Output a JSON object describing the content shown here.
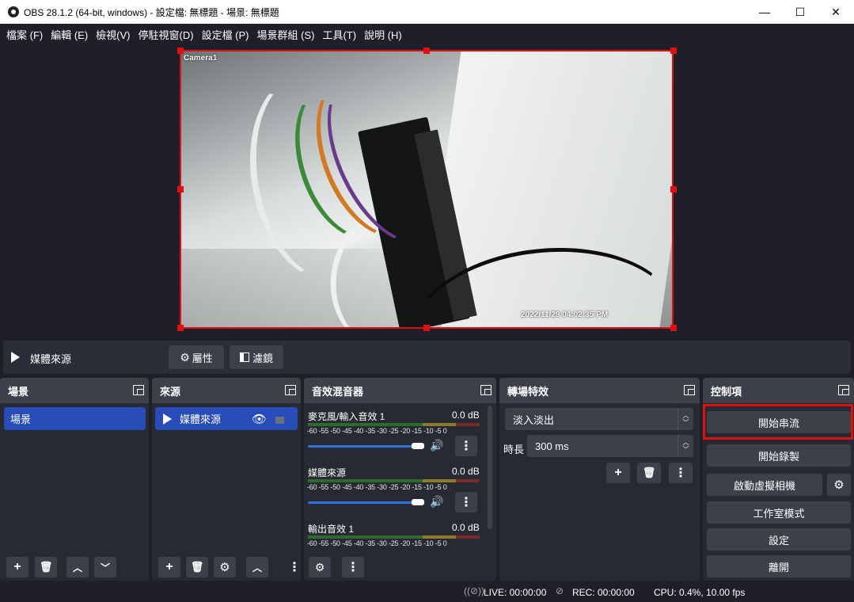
{
  "window": {
    "title": "OBS 28.1.2 (64-bit, windows) - 設定檔: 無標題 - 場景: 無標題",
    "minimize": "—",
    "maximize": "☐",
    "close": "✕"
  },
  "menu": [
    "檔案 (F)",
    "編輯 (E)",
    "檢視(V)",
    "停駐視窗(D)",
    "設定檔 (P)",
    "場景群組 (S)",
    "工具(T)",
    "說明 (H)"
  ],
  "preview": {
    "camera_label": "Camera1",
    "timestamp": "2022/11/29 04:02:35 PM",
    "selection_color": "#e01010"
  },
  "source_bar": {
    "source_name": "媒體來源",
    "properties_label": "屬性",
    "filters_label": "濾鏡"
  },
  "scenes": {
    "title": "場景",
    "items": [
      "場景"
    ]
  },
  "sources": {
    "title": "來源",
    "items": [
      "媒體來源"
    ]
  },
  "mixer": {
    "title": "音效混音器",
    "scale": [
      "-60",
      "-55",
      "-50",
      "-45",
      "-40",
      "-35",
      "-30",
      "-25",
      "-20",
      "-15",
      "-10",
      "-5",
      "0"
    ],
    "channels": [
      {
        "name": "麥克風/輸入音效 1",
        "level": "0.0 dB",
        "volume": 1.0
      },
      {
        "name": "媒體來源",
        "level": "0.0 dB",
        "volume": 1.0
      },
      {
        "name": "輸出音效 1",
        "level": "0.0 dB",
        "volume": 1.0
      }
    ]
  },
  "transitions": {
    "title": "轉場特效",
    "selected": "淡入淡出",
    "duration_label": "時長",
    "duration_value": "300 ms"
  },
  "controls": {
    "title": "控制項",
    "buttons": [
      "開始串流",
      "開始錄製",
      "啟動虛擬相機",
      "工作室模式",
      "設定",
      "離開"
    ],
    "highlight_color": "#e01010"
  },
  "status": {
    "live": "LIVE: 00:00:00",
    "rec": "REC: 00:00:00",
    "cpu": "CPU: 0.4%, 10.00 fps"
  },
  "colors": {
    "accent": "#284cb8",
    "panel": "#272a33",
    "button": "#3c404b",
    "background": "#1e1f29"
  }
}
